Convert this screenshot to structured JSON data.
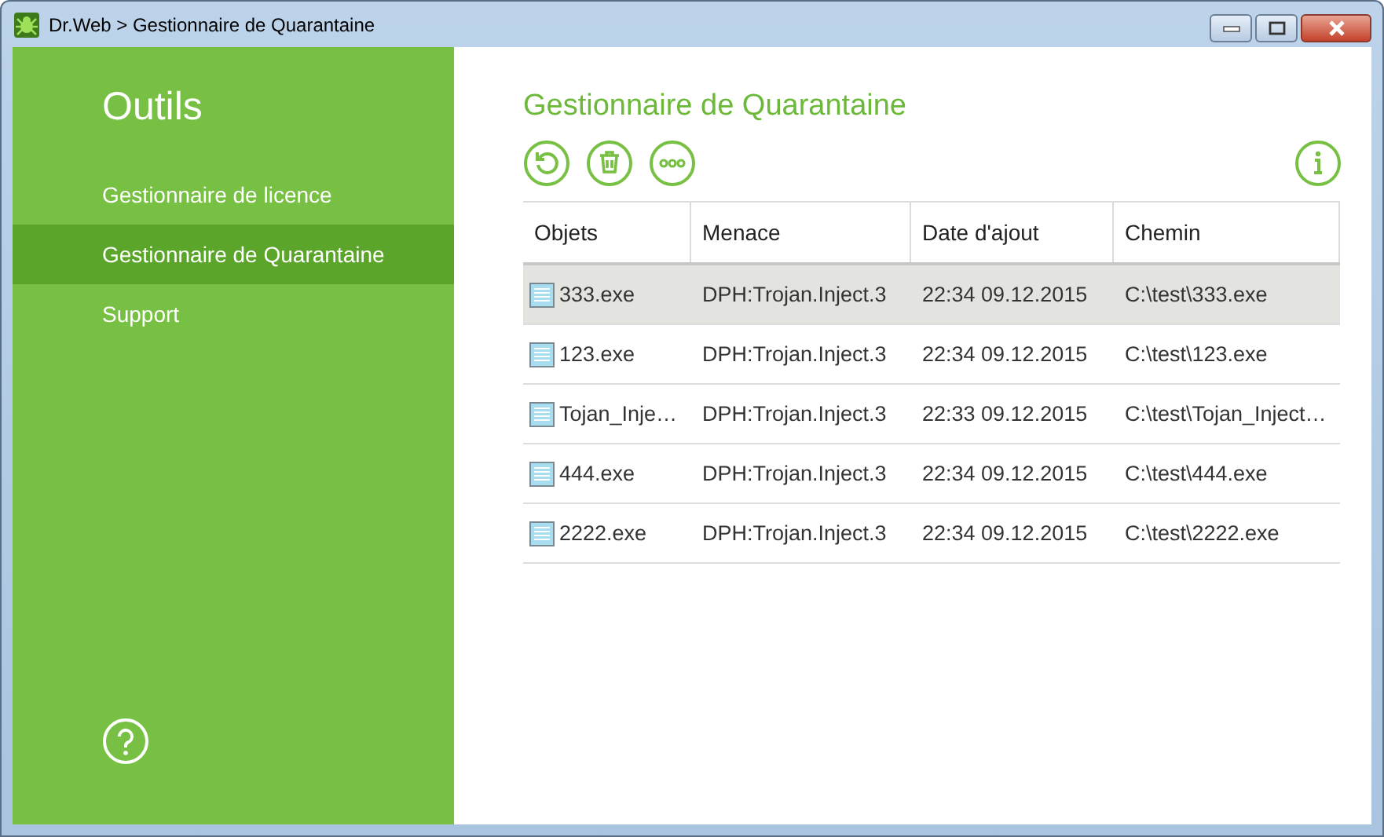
{
  "window": {
    "title": "Dr.Web > Gestionnaire de Quarantaine"
  },
  "sidebar": {
    "heading": "Outils",
    "items": [
      {
        "label": "Gestionnaire de licence",
        "selected": false
      },
      {
        "label": "Gestionnaire de Quarantaine",
        "selected": true
      },
      {
        "label": "Support",
        "selected": false
      }
    ]
  },
  "page_title": "Gestionnaire de Quarantaine",
  "table": {
    "columns": [
      "Objets",
      "Menace",
      "Date d'ajout",
      "Chemin"
    ],
    "rows": [
      {
        "selected": true,
        "cells": [
          "333.exe",
          "DPH:Trojan.Inject.3",
          "22:34 09.12.2015",
          "C:\\test\\333.exe"
        ]
      },
      {
        "selected": false,
        "cells": [
          "123.exe",
          "DPH:Trojan.Inject.3",
          "22:34 09.12.2015",
          "C:\\test\\123.exe"
        ]
      },
      {
        "selected": false,
        "cells": [
          "Tojan_Inje…",
          "DPH:Trojan.Inject.3",
          "22:33 09.12.2015",
          "C:\\test\\Tojan_Inject…"
        ]
      },
      {
        "selected": false,
        "cells": [
          "444.exe",
          "DPH:Trojan.Inject.3",
          "22:34 09.12.2015",
          "C:\\test\\444.exe"
        ]
      },
      {
        "selected": false,
        "cells": [
          "2222.exe",
          "DPH:Trojan.Inject.3",
          "22:34 09.12.2015",
          "C:\\test\\2222.exe"
        ]
      }
    ]
  }
}
